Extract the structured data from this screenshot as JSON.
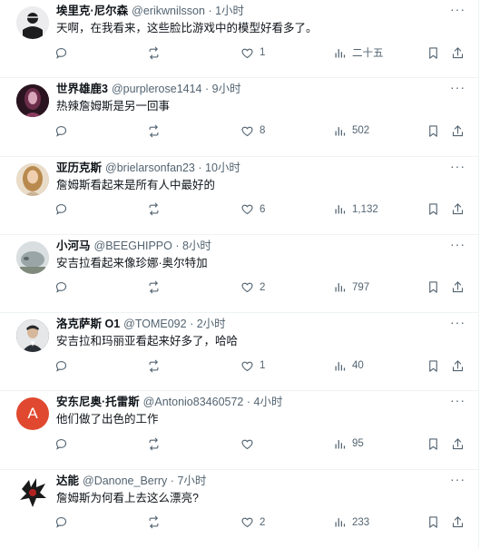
{
  "tweets": [
    {
      "name": "埃里克·尼尔森",
      "handle": "@erikwnilsson",
      "time": "1小时",
      "text": "天啊，在我看来，这些脸比游戏中的模型好看多了。",
      "replies": "",
      "retweets": "",
      "likes": "1",
      "views": "二十五",
      "avatar_color": "#e8e8ea"
    },
    {
      "name": "世界雄鹿3",
      "handle": "@purplerose1414",
      "time": "9小时",
      "text": "热辣詹姆斯是另一回事",
      "replies": "",
      "retweets": "",
      "likes": "8",
      "views": "502",
      "avatar_color": "#3a1f2e"
    },
    {
      "name": "亚历克斯",
      "handle": "@brielarsonfan23",
      "time": "10小时",
      "text": "詹姆斯看起来是所有人中最好的",
      "replies": "",
      "retweets": "",
      "likes": "6",
      "views": "1,132",
      "avatar_color": "#d8c3a8"
    },
    {
      "name": "小河马",
      "handle": "@BEEGHIPPO",
      "time": "8小时",
      "text": "安吉拉看起来像珍娜·奥尔特加",
      "replies": "",
      "retweets": "",
      "likes": "2",
      "views": "797",
      "avatar_color": "#cfd6d9"
    },
    {
      "name": "洛克萨斯 O1",
      "handle": "@TOME092",
      "time": "2小时",
      "text": "安吉拉和玛丽亚看起来好多了，哈哈",
      "replies": "",
      "retweets": "",
      "likes": "1",
      "views": "40",
      "avatar_color": "#2b2f36"
    },
    {
      "name": "安东尼奥·托雷斯",
      "handle": "@Antonio83460572",
      "time": "4小时",
      "text": "他们做了出色的工作",
      "replies": "",
      "retweets": "",
      "likes": "",
      "views": "95",
      "avatar_color": "#e0492f",
      "avatar_letter": "A"
    },
    {
      "name": "达能",
      "handle": "@Danone_Berry",
      "time": "7小时",
      "text": "詹姆斯为何看上去这么漂亮?",
      "replies": "",
      "retweets": "",
      "likes": "2",
      "views": "233",
      "avatar_color": "#1a1a1a"
    }
  ],
  "separator": "·",
  "more_label": "···"
}
